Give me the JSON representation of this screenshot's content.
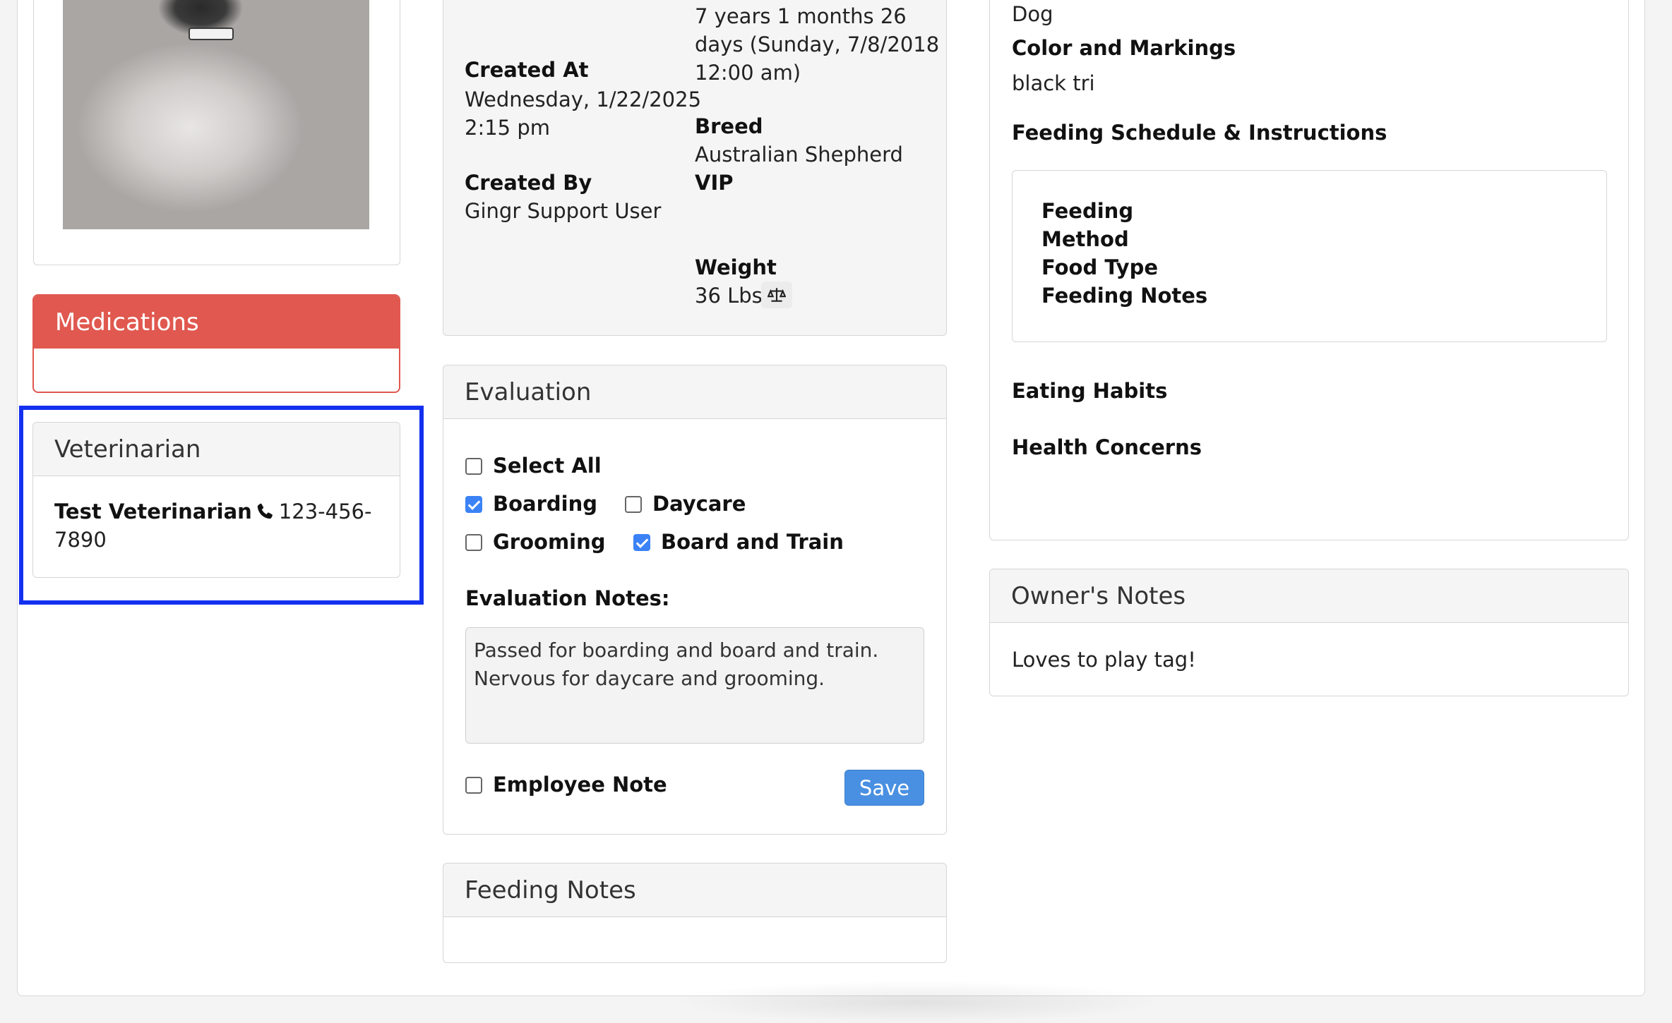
{
  "photo": {
    "alt": "dog-photo"
  },
  "medications": {
    "title": "Medications"
  },
  "veterinarian": {
    "title": "Veterinarian",
    "name": "Test Veterinarian",
    "phone_line1": "123-456-",
    "phone_line2": "7890"
  },
  "info": {
    "age_line1": "7 years 1 months 26",
    "age_line2": "days (Sunday, 7/8/2018",
    "age_line3": "12:00 am)",
    "created_at_label": "Created At",
    "created_at_line1": "Wednesday, 1/22/2025",
    "created_at_line2": "2:15 pm",
    "created_by_label": "Created By",
    "created_by_value": "Gingr Support User",
    "breed_label": "Breed",
    "breed_value": "Australian Shepherd",
    "vip_label": "VIP",
    "weight_label": "Weight",
    "weight_value": "36 Lbs"
  },
  "evaluation": {
    "title": "Evaluation",
    "options": [
      {
        "label": "Select All",
        "checked": false
      },
      {
        "label": "Boarding",
        "checked": true
      },
      {
        "label": "Daycare",
        "checked": false
      },
      {
        "label": "Grooming",
        "checked": false
      },
      {
        "label": "Board and Train",
        "checked": true
      }
    ],
    "notes_label": "Evaluation Notes:",
    "notes_line1": "Passed for boarding and board and train.",
    "notes_line2": "Nervous for daycare and grooming.",
    "employee_note_label": "Employee Note",
    "save_label": "Save"
  },
  "feeding_notes": {
    "title": "Feeding Notes"
  },
  "right": {
    "species": "Dog",
    "color_label": "Color and Markings",
    "color_value": "black tri",
    "schedule_label": "Feeding Schedule & Instructions",
    "schedule_fields": [
      "Feeding",
      "Method",
      "Food Type",
      "Feeding Notes"
    ],
    "eating_habits_label": "Eating Habits",
    "health_concerns_label": "Health Concerns"
  },
  "owner_notes": {
    "title": "Owner's Notes",
    "text": "Loves to play tag!"
  },
  "colors": {
    "danger": "#e0584f",
    "primary": "#4a90e2",
    "highlight": "#1330f0",
    "check": "#3b82f6"
  }
}
